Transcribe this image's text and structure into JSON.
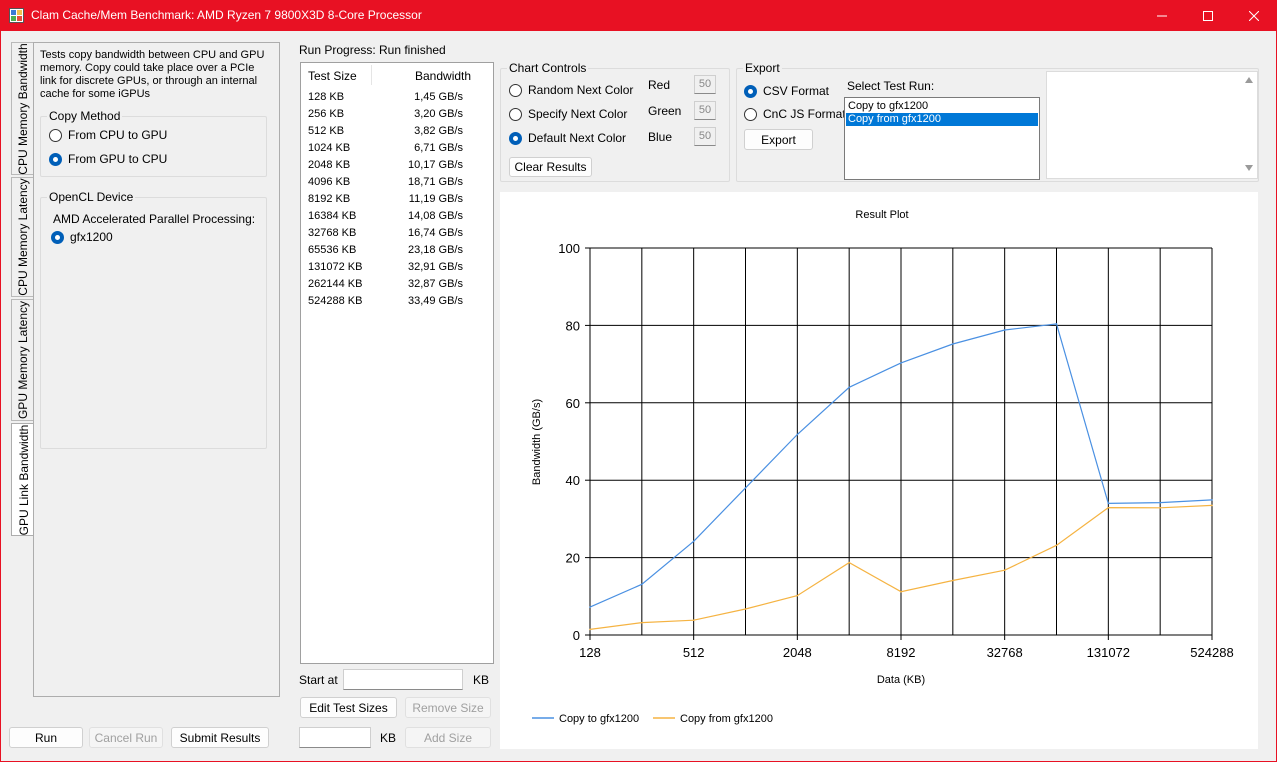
{
  "window": {
    "title": "Clam Cache/Mem Benchmark: AMD Ryzen 7 9800X3D 8-Core Processor",
    "accent": "#e81123"
  },
  "tabs": [
    {
      "label": "CPU Memory Bandwidth",
      "selected": false
    },
    {
      "label": "CPU Memory Latency",
      "selected": false
    },
    {
      "label": "GPU Memory Latency",
      "selected": false
    },
    {
      "label": "GPU Link Bandwidth",
      "selected": true
    }
  ],
  "left": {
    "description": "Tests copy bandwidth between CPU and GPU memory. Copy could take place over a PCIe link for discrete GPUs, or through an internal cache for some iGPUs",
    "copy_method": {
      "label": "Copy Method",
      "options": [
        {
          "label": "From CPU to GPU",
          "checked": false
        },
        {
          "label": "From GPU to CPU",
          "checked": true
        }
      ]
    },
    "opencl": {
      "label": "OpenCL Device",
      "platform": "AMD Accelerated Parallel Processing:",
      "device": {
        "label": "gfx1200",
        "checked": true
      }
    }
  },
  "bottom_buttons": {
    "run": "Run",
    "cancel": "Cancel Run",
    "submit": "Submit Results"
  },
  "progress": {
    "label": "Run Progress:",
    "value": "Run finished"
  },
  "results": {
    "columns": [
      "Test Size",
      "Bandwidth"
    ],
    "rows": [
      [
        "128 KB",
        "1,45 GB/s"
      ],
      [
        "256 KB",
        "3,20 GB/s"
      ],
      [
        "512 KB",
        "3,82 GB/s"
      ],
      [
        "1024 KB",
        "6,71 GB/s"
      ],
      [
        "2048 KB",
        "10,17 GB/s"
      ],
      [
        "4096 KB",
        "18,71 GB/s"
      ],
      [
        "8192 KB",
        "11,19 GB/s"
      ],
      [
        "16384 KB",
        "14,08 GB/s"
      ],
      [
        "32768 KB",
        "16,74 GB/s"
      ],
      [
        "65536 KB",
        "23,18 GB/s"
      ],
      [
        "131072 KB",
        "32,91 GB/s"
      ],
      [
        "262144 KB",
        "32,87 GB/s"
      ],
      [
        "524288 KB",
        "33,49 GB/s"
      ]
    ]
  },
  "size_controls": {
    "start_label": "Start at",
    "start_value": "",
    "unit1": "KB",
    "edit": "Edit Test Sizes",
    "remove": "Remove Size",
    "add_value": "",
    "unit2": "KB",
    "add": "Add Size"
  },
  "chart_controls": {
    "label": "Chart Controls",
    "options": [
      {
        "label": "Random Next Color",
        "checked": false
      },
      {
        "label": "Specify Next Color",
        "checked": false
      },
      {
        "label": "Default Next Color",
        "checked": true
      }
    ],
    "red_label": "Red",
    "red": "50",
    "green_label": "Green",
    "green": "50",
    "blue_label": "Blue",
    "blue": "50",
    "clear": "Clear Results"
  },
  "export": {
    "label": "Export",
    "options": [
      {
        "label": "CSV Format",
        "checked": true
      },
      {
        "label": "CnC JS Format",
        "checked": false
      }
    ],
    "button": "Export",
    "select_label": "Select Test Run:",
    "runs": [
      {
        "label": "Copy to gfx1200",
        "selected": false
      },
      {
        "label": "Copy from gfx1200",
        "selected": true
      }
    ]
  },
  "chart_data": {
    "type": "line",
    "title": "Result Plot",
    "xlabel": "Data (KB)",
    "ylabel": "Bandwidth (GB/s)",
    "x_scale": "log2",
    "xlim": [
      128,
      524288
    ],
    "ylim": [
      0,
      100
    ],
    "x_ticks": [
      128,
      512,
      2048,
      8192,
      32768,
      131072,
      524288
    ],
    "y_ticks": [
      0,
      20,
      40,
      60,
      80,
      100
    ],
    "grid": true,
    "legend": "bottom-left",
    "series": [
      {
        "name": "Copy to gfx1200",
        "color": "#4a90e2",
        "x": [
          128,
          256,
          512,
          1024,
          2048,
          4096,
          8192,
          16384,
          32768,
          65536,
          131072,
          262144,
          524288
        ],
        "y": [
          7.2,
          13.1,
          24.2,
          38.0,
          51.8,
          64.0,
          70.3,
          75.2,
          78.8,
          80.4,
          34.0,
          34.2,
          34.9
        ]
      },
      {
        "name": "Copy from gfx1200",
        "color": "#f5b342",
        "x": [
          128,
          256,
          512,
          1024,
          2048,
          4096,
          8192,
          16384,
          32768,
          65536,
          131072,
          262144,
          524288
        ],
        "y": [
          1.45,
          3.2,
          3.82,
          6.71,
          10.17,
          18.71,
          11.19,
          14.08,
          16.74,
          23.18,
          32.91,
          32.87,
          33.49
        ]
      }
    ]
  }
}
